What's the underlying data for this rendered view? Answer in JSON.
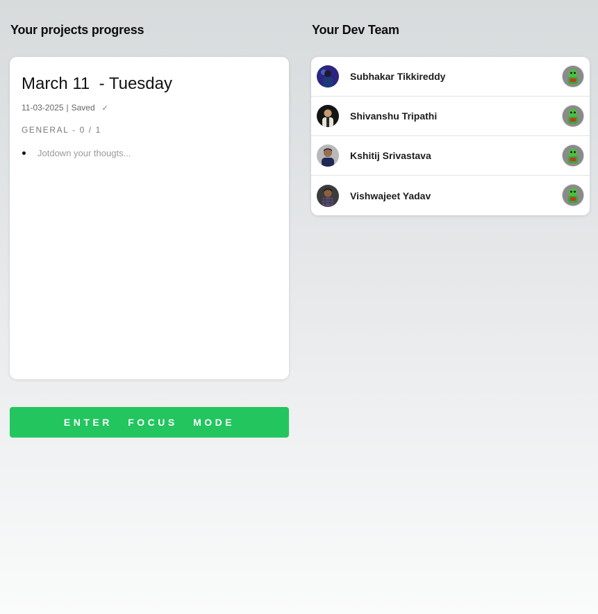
{
  "projects": {
    "title": "Your projects progress",
    "journal": {
      "date_heading": "March 11  - Tuesday",
      "date_stamp": "11-03-2025",
      "separator": "|",
      "save_status": "Saved",
      "category": "GENERAL - 0 / 1",
      "entry_placeholder": "Jotdown your thougts..."
    },
    "focus_button_label": "ENTER FOCUS MODE"
  },
  "team": {
    "title": "Your Dev Team",
    "members": [
      {
        "name": "Subhakar Tikkireddy"
      },
      {
        "name": "Shivanshu Tripathi"
      },
      {
        "name": "Kshitij Srivastava"
      },
      {
        "name": "Vishwajeet Yadav"
      }
    ]
  },
  "colors": {
    "accent": "#22c55e"
  }
}
